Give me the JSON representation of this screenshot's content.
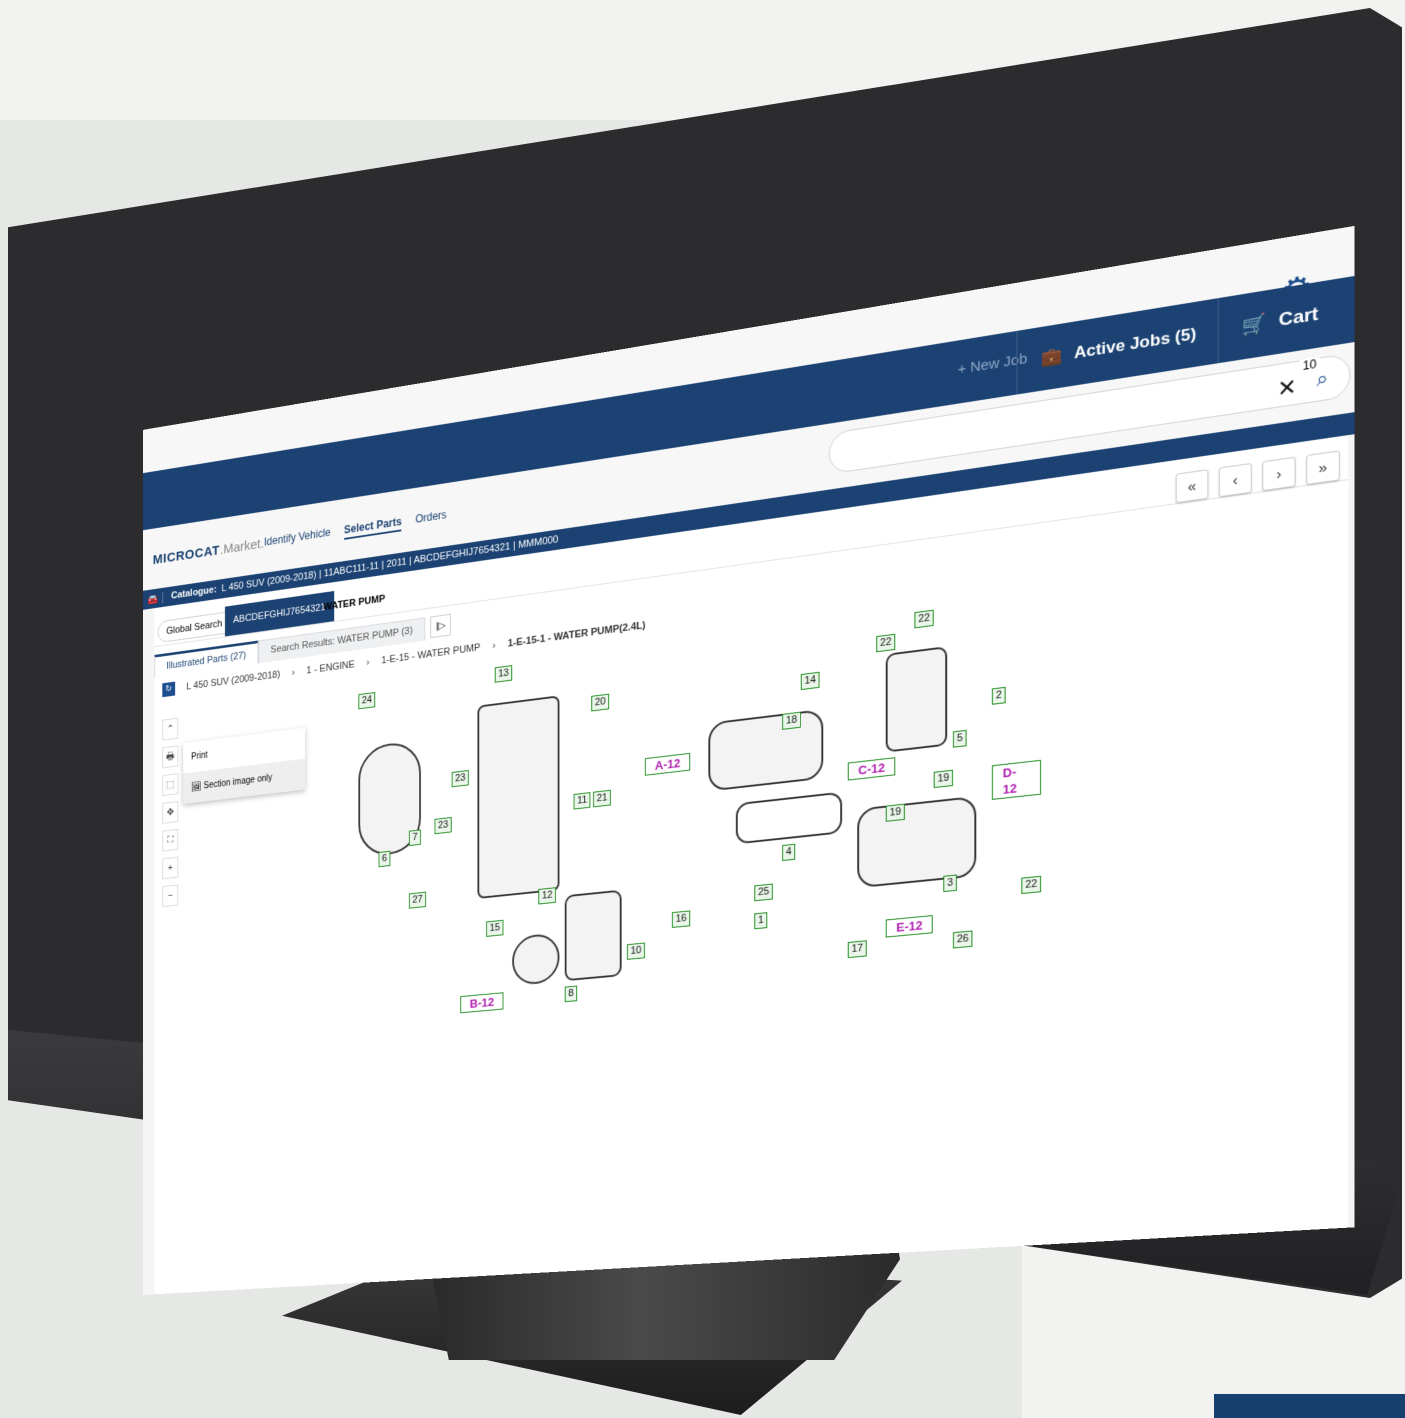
{
  "header": {
    "cart_label": "Cart",
    "cart_count": "10",
    "active_jobs_label": "Active Jobs (5)",
    "new_job_label": "+ New Job"
  },
  "brand": {
    "name_bold": "MICROCAT",
    "name_light": ".Market."
  },
  "nav": {
    "identify": "Identify Vehicle",
    "select": "Select Parts",
    "orders": "Orders"
  },
  "catalogue": {
    "label": "Catalogue:",
    "value": "L 450 SUV (2009-2018) | 11ABC111-11 | 2011 | ABCDEFGHIJ7654321 | MMM000"
  },
  "search": {
    "scope": "Global Search",
    "vin": "ABCDEFGHIJ7654321",
    "term": "WATER PUMP"
  },
  "pager": {
    "first": "«",
    "prev": "‹",
    "next": "›",
    "last": "»"
  },
  "tabs": {
    "illustrated": "Illustrated Parts (27)",
    "results": "Search Results: WATER PUMP (3)"
  },
  "breadcrumb": {
    "root": "L 450 SUV (2009-2018)",
    "l1": "1 - ENGINE",
    "l2": "1-E-15 - WATER PUMP",
    "l3": "1-E-15-1 - WATER PUMP(2.4L)"
  },
  "print_menu": {
    "title": "Print",
    "option": "Section image only"
  },
  "callouts": [
    "24",
    "13",
    "20",
    "23",
    "11",
    "21",
    "23",
    "7",
    "6",
    "27",
    "12",
    "15",
    "10",
    "16",
    "8",
    "14",
    "18",
    "4",
    "22",
    "22",
    "2",
    "5",
    "19",
    "19",
    "3",
    "25",
    "1",
    "17",
    "26",
    "22"
  ],
  "section_refs": [
    "A-12",
    "B-12",
    "C-12",
    "D-12",
    "E-12"
  ],
  "colors": {
    "brand_navy": "#1b4272",
    "callout_green": "#1a8a1a",
    "section_magenta": "#b01fb0"
  }
}
